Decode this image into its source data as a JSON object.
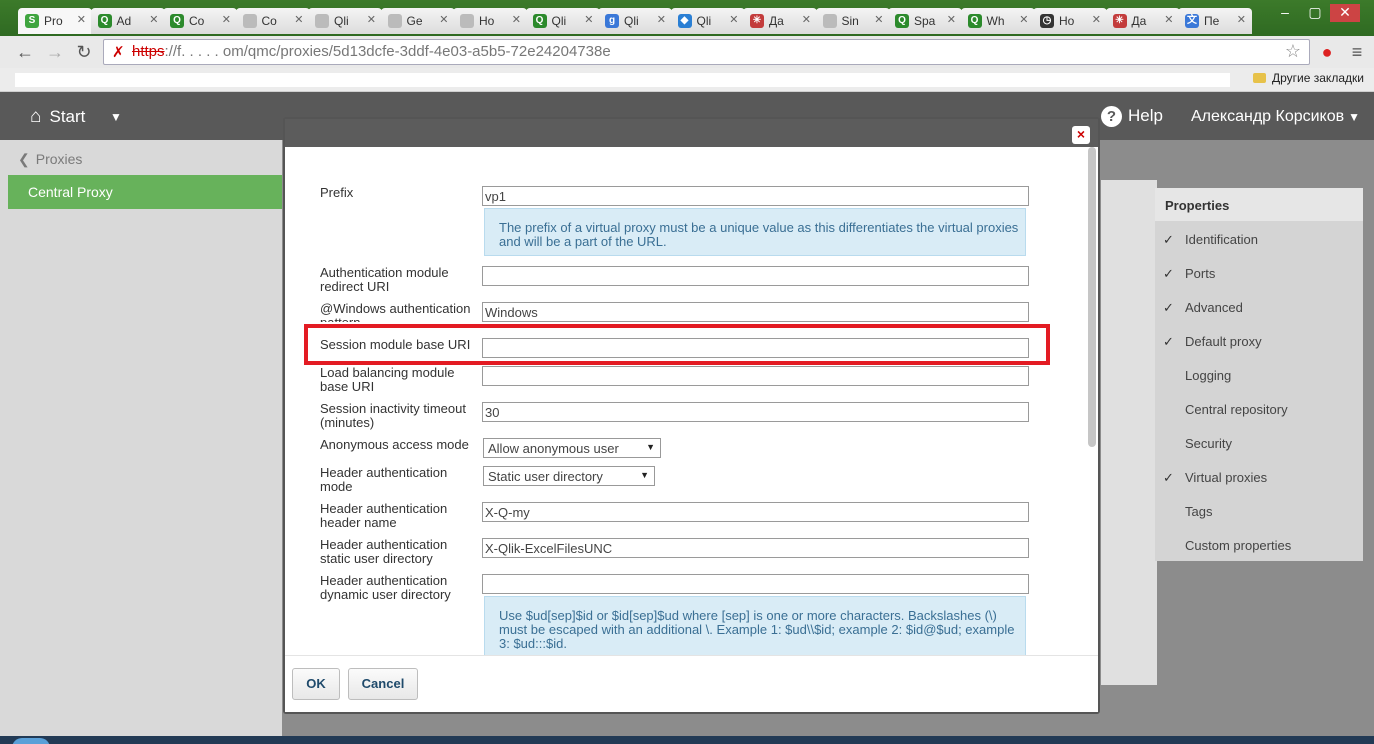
{
  "browser": {
    "tabs": [
      {
        "label": "Pro",
        "icon": "qlik-sense-icon",
        "color": "#3fa53f"
      },
      {
        "label": "Ad",
        "icon": "qlik-icon",
        "color": "#2c8a2c"
      },
      {
        "label": "Co",
        "icon": "qlik-icon",
        "color": "#2c8a2c"
      },
      {
        "label": "Co",
        "icon": "page-icon",
        "color": "#bbbbbb"
      },
      {
        "label": "Qli",
        "icon": "page-icon",
        "color": "#bbbbbb"
      },
      {
        "label": "Ge",
        "icon": "page-icon",
        "color": "#bbbbbb"
      },
      {
        "label": "Ho",
        "icon": "page-icon",
        "color": "#bbbbbb"
      },
      {
        "label": "Qli",
        "icon": "qlik-icon",
        "color": "#2c8a2c"
      },
      {
        "label": "Qli",
        "icon": "google-icon",
        "color": "#3a78d8"
      },
      {
        "label": "Qli",
        "icon": "dropbox-icon",
        "color": "#2a7fd4"
      },
      {
        "label": "Да",
        "icon": "asterisk-icon",
        "color": "#c33c3c"
      },
      {
        "label": "Sin",
        "icon": "page-icon",
        "color": "#bbbbbb"
      },
      {
        "label": "Spa",
        "icon": "qlik-icon",
        "color": "#2c8a2c"
      },
      {
        "label": "Wh",
        "icon": "qlik-icon",
        "color": "#2c8a2c"
      },
      {
        "label": "Ho",
        "icon": "clock-icon",
        "color": "#333333"
      },
      {
        "label": "Да",
        "icon": "asterisk-icon",
        "color": "#c33c3c"
      },
      {
        "label": "Пе",
        "icon": "translate-icon",
        "color": "#3a78d8"
      }
    ],
    "url_protocol": "https",
    "url_host": "://f.  .  .  .  . om",
    "url_path": "/qmc/proxies/5d13dcfe-3ddf-4e03-a5b5-72e24204738e",
    "other_bookmarks": "Другие закладки"
  },
  "qmc": {
    "start_label": "Start",
    "help_label": "Help",
    "user_name": "Александр Корсиков",
    "back_label": "Proxies",
    "selected_item": "Central Proxy"
  },
  "properties": {
    "title": "Properties",
    "items": [
      {
        "label": "Identification",
        "checked": true
      },
      {
        "label": "Ports",
        "checked": true
      },
      {
        "label": "Advanced",
        "checked": true
      },
      {
        "label": "Default proxy",
        "checked": true
      },
      {
        "label": "Logging",
        "checked": false
      },
      {
        "label": "Central repository",
        "checked": false
      },
      {
        "label": "Security",
        "checked": false
      },
      {
        "label": "Virtual proxies",
        "checked": true
      },
      {
        "label": "Tags",
        "checked": false
      },
      {
        "label": "Custom properties",
        "checked": false
      }
    ],
    "check_mark": "✓"
  },
  "dialog": {
    "fields": {
      "prefix_label": "Prefix",
      "prefix_value": "vp1",
      "prefix_info": "The prefix of a virtual proxy must be a unique value as this differentiates the virtual proxies and will be a part of the URL.",
      "auth_redirect_label": "Authentication module redirect URI",
      "auth_redirect_value": "",
      "windows_pattern_label": "@Windows authentication pattern",
      "windows_pattern_value": "Windows",
      "session_base_label": "Session module base URI",
      "session_base_value": "",
      "load_balancing_label": "Load balancing module base URI",
      "load_balancing_value": "",
      "inactivity_label": "Session inactivity timeout (minutes)",
      "inactivity_value": "30",
      "anon_label": "Anonymous access mode",
      "anon_value": "Allow anonymous user",
      "header_mode_label": "Header authentication mode",
      "header_mode_value": "Static user directory",
      "header_name_label": "Header authentication header name",
      "header_name_value": "X-Q-my",
      "static_dir_label": "Header authentication static user directory",
      "static_dir_value": "X-Qlik-ExcelFilesUNC",
      "dynamic_dir_label": "Header authentication dynamic user directory",
      "dynamic_dir_value": "",
      "dynamic_info": "Use $ud[sep]$id or $id[sep]$ud where [sep] is one or more characters. Backslashes (\\) must be escaped with an additional \\. Example 1: $ud\\\\$id; example 2: $id@$ud; example 3: $ud:::$id."
    },
    "ok_label": "OK",
    "cancel_label": "Cancel",
    "close_glyph": "×"
  },
  "colors": {
    "accent_green": "#67b25b",
    "highlight_red": "#e31b23",
    "info_bg": "#d9ecf6"
  }
}
